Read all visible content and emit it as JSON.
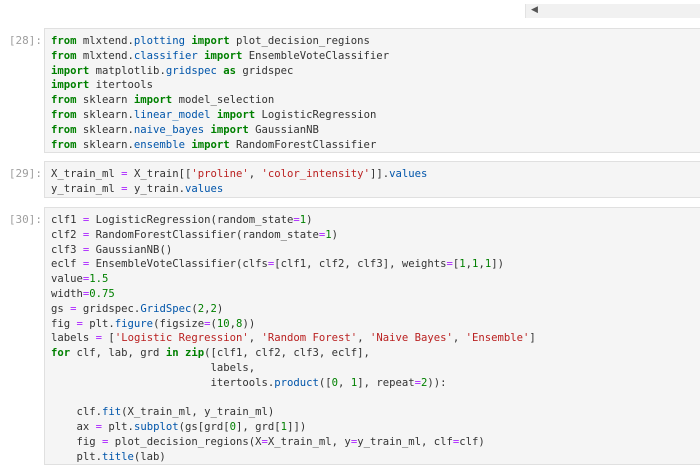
{
  "cells": [
    {
      "prompt": "[28]:",
      "lines": [
        [
          [
            "kw",
            "from"
          ],
          [
            "t",
            " mlxtend."
          ],
          [
            "mod",
            "plotting"
          ],
          [
            "t",
            " "
          ],
          [
            "kw",
            "import"
          ],
          [
            "t",
            " plot_decision_regions"
          ]
        ],
        [
          [
            "kw",
            "from"
          ],
          [
            "t",
            " mlxtend."
          ],
          [
            "mod",
            "classifier"
          ],
          [
            "t",
            " "
          ],
          [
            "kw",
            "import"
          ],
          [
            "t",
            " EnsembleVoteClassifier"
          ]
        ],
        [
          [
            "kw",
            "import"
          ],
          [
            "t",
            " matplotlib."
          ],
          [
            "mod",
            "gridspec"
          ],
          [
            "t",
            " "
          ],
          [
            "kw",
            "as"
          ],
          [
            "t",
            " gridspec"
          ]
        ],
        [
          [
            "kw",
            "import"
          ],
          [
            "t",
            " itertools"
          ]
        ],
        [
          [
            "kw",
            "from"
          ],
          [
            "t",
            " sklearn "
          ],
          [
            "kw",
            "import"
          ],
          [
            "t",
            " model_selection"
          ]
        ],
        [
          [
            "kw",
            "from"
          ],
          [
            "t",
            " sklearn."
          ],
          [
            "mod",
            "linear_model"
          ],
          [
            "t",
            " "
          ],
          [
            "kw",
            "import"
          ],
          [
            "t",
            " LogisticRegression"
          ]
        ],
        [
          [
            "kw",
            "from"
          ],
          [
            "t",
            " sklearn."
          ],
          [
            "mod",
            "naive_bayes"
          ],
          [
            "t",
            " "
          ],
          [
            "kw",
            "import"
          ],
          [
            "t",
            " GaussianNB"
          ]
        ],
        [
          [
            "kw",
            "from"
          ],
          [
            "t",
            " sklearn."
          ],
          [
            "mod",
            "ensemble"
          ],
          [
            "t",
            " "
          ],
          [
            "kw",
            "import"
          ],
          [
            "t",
            " RandomForestClassifier"
          ]
        ]
      ]
    },
    {
      "prompt": "[29]:",
      "lines": [
        [
          [
            "t",
            "X_train_ml "
          ],
          [
            "op",
            "="
          ],
          [
            "t",
            " X_train[["
          ],
          [
            "str",
            "'proline'"
          ],
          [
            "t",
            ", "
          ],
          [
            "str",
            "'color_intensity'"
          ],
          [
            "t",
            "]]."
          ],
          [
            "mod",
            "values"
          ]
        ],
        [
          [
            "t",
            "y_train_ml "
          ],
          [
            "op",
            "="
          ],
          [
            "t",
            " y_train."
          ],
          [
            "mod",
            "values"
          ]
        ]
      ]
    },
    {
      "prompt": "[30]:",
      "lines": [
        [
          [
            "t",
            "clf1 "
          ],
          [
            "op",
            "="
          ],
          [
            "t",
            " LogisticRegression(random_state"
          ],
          [
            "op",
            "="
          ],
          [
            "num",
            "1"
          ],
          [
            "t",
            ")"
          ]
        ],
        [
          [
            "t",
            "clf2 "
          ],
          [
            "op",
            "="
          ],
          [
            "t",
            " RandomForestClassifier(random_state"
          ],
          [
            "op",
            "="
          ],
          [
            "num",
            "1"
          ],
          [
            "t",
            ")"
          ]
        ],
        [
          [
            "t",
            "clf3 "
          ],
          [
            "op",
            "="
          ],
          [
            "t",
            " GaussianNB()"
          ]
        ],
        [
          [
            "t",
            "eclf "
          ],
          [
            "op",
            "="
          ],
          [
            "t",
            " EnsembleVoteClassifier(clfs"
          ],
          [
            "op",
            "="
          ],
          [
            "t",
            "[clf1, clf2, clf3], weights"
          ],
          [
            "op",
            "="
          ],
          [
            "t",
            "["
          ],
          [
            "num",
            "1"
          ],
          [
            "t",
            ","
          ],
          [
            "num",
            "1"
          ],
          [
            "t",
            ","
          ],
          [
            "num",
            "1"
          ],
          [
            "t",
            "])"
          ]
        ],
        [
          [
            "t",
            "value"
          ],
          [
            "op",
            "="
          ],
          [
            "num",
            "1.5"
          ]
        ],
        [
          [
            "t",
            "width"
          ],
          [
            "op",
            "="
          ],
          [
            "num",
            "0.75"
          ]
        ],
        [
          [
            "t",
            "gs "
          ],
          [
            "op",
            "="
          ],
          [
            "t",
            " gridspec."
          ],
          [
            "mod",
            "GridSpec"
          ],
          [
            "t",
            "("
          ],
          [
            "num",
            "2"
          ],
          [
            "t",
            ","
          ],
          [
            "num",
            "2"
          ],
          [
            "t",
            ")"
          ]
        ],
        [
          [
            "t",
            "fig "
          ],
          [
            "op",
            "="
          ],
          [
            "t",
            " plt."
          ],
          [
            "mod",
            "figure"
          ],
          [
            "t",
            "(figsize"
          ],
          [
            "op",
            "="
          ],
          [
            "t",
            "("
          ],
          [
            "num",
            "10"
          ],
          [
            "t",
            ","
          ],
          [
            "num",
            "8"
          ],
          [
            "t",
            "))"
          ]
        ],
        [
          [
            "t",
            "labels "
          ],
          [
            "op",
            "="
          ],
          [
            "t",
            " ["
          ],
          [
            "str",
            "'Logistic Regression'"
          ],
          [
            "t",
            ", "
          ],
          [
            "str",
            "'Random Forest'"
          ],
          [
            "t",
            ", "
          ],
          [
            "str",
            "'Naive Bayes'"
          ],
          [
            "t",
            ", "
          ],
          [
            "str",
            "'Ensemble'"
          ],
          [
            "t",
            "]"
          ]
        ],
        [
          [
            "kw",
            "for"
          ],
          [
            "t",
            " clf, lab, grd "
          ],
          [
            "kw",
            "in"
          ],
          [
            "t",
            " "
          ],
          [
            "kw",
            "zip"
          ],
          [
            "t",
            "([clf1, clf2, clf3, eclf],"
          ]
        ],
        [
          [
            "t",
            "                         labels,"
          ]
        ],
        [
          [
            "t",
            "                         itertools."
          ],
          [
            "mod",
            "product"
          ],
          [
            "t",
            "(["
          ],
          [
            "num",
            "0"
          ],
          [
            "t",
            ", "
          ],
          [
            "num",
            "1"
          ],
          [
            "t",
            "], repeat"
          ],
          [
            "op",
            "="
          ],
          [
            "num",
            "2"
          ],
          [
            "t",
            ")):"
          ]
        ],
        [
          [
            "t",
            ""
          ]
        ],
        [
          [
            "t",
            "    clf."
          ],
          [
            "mod",
            "fit"
          ],
          [
            "t",
            "(X_train_ml, y_train_ml)"
          ]
        ],
        [
          [
            "t",
            "    ax "
          ],
          [
            "op",
            "="
          ],
          [
            "t",
            " plt."
          ],
          [
            "mod",
            "subplot"
          ],
          [
            "t",
            "(gs[grd["
          ],
          [
            "num",
            "0"
          ],
          [
            "t",
            "], grd["
          ],
          [
            "num",
            "1"
          ],
          [
            "t",
            "]])"
          ]
        ],
        [
          [
            "t",
            "    fig "
          ],
          [
            "op",
            "="
          ],
          [
            "t",
            " plot_decision_regions(X"
          ],
          [
            "op",
            "="
          ],
          [
            "t",
            "X_train_ml, y"
          ],
          [
            "op",
            "="
          ],
          [
            "t",
            "y_train_ml, clf"
          ],
          [
            "op",
            "="
          ],
          [
            "t",
            "clf)"
          ]
        ],
        [
          [
            "t",
            "    plt."
          ],
          [
            "mod",
            "title"
          ],
          [
            "t",
            "(lab)"
          ]
        ]
      ]
    }
  ]
}
